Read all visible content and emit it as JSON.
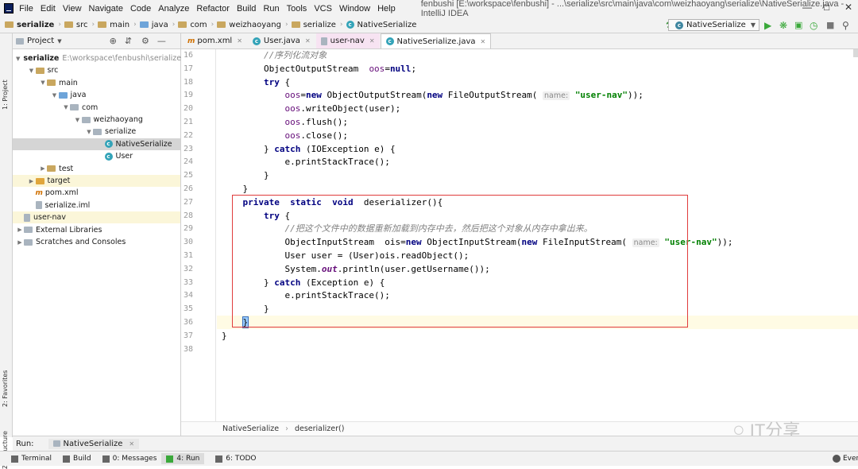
{
  "menu": {
    "items": [
      "File",
      "Edit",
      "View",
      "Navigate",
      "Code",
      "Analyze",
      "Refactor",
      "Build",
      "Run",
      "Tools",
      "VCS",
      "Window",
      "Help"
    ],
    "window_title": "fenbushi [E:\\workspace\\fenbushi] - ...\\serialize\\src\\main\\java\\com\\weizhaoyang\\serialize\\NativeSerialize.java - IntelliJ IDEA"
  },
  "navbar": {
    "crumbs": [
      "serialize",
      "src",
      "main",
      "java",
      "com",
      "weizhaoyang",
      "serialize",
      "NativeSerialize"
    ],
    "run_config": "NativeSerialize"
  },
  "left_strip": {
    "project_tab": "1: Project",
    "favorites_tab": "2: Favorites",
    "structure_tab": "Z: Structure"
  },
  "project_panel": {
    "header": "Project",
    "tree": [
      {
        "label": "serialize",
        "path": "E:\\workspace\\fenbushi\\serialize",
        "depth": 0,
        "icon": "module-folder-icon",
        "open": true,
        "bold": true
      },
      {
        "label": "src",
        "depth": 1,
        "icon": "folder-icon",
        "open": true
      },
      {
        "label": "main",
        "depth": 2,
        "icon": "folder-icon",
        "open": true
      },
      {
        "label": "java",
        "depth": 3,
        "icon": "source-folder-icon",
        "open": true
      },
      {
        "label": "com",
        "depth": 4,
        "icon": "package-icon",
        "open": true
      },
      {
        "label": "weizhaoyang",
        "depth": 5,
        "icon": "package-icon",
        "open": true
      },
      {
        "label": "serialize",
        "depth": 6,
        "icon": "package-icon",
        "open": true
      },
      {
        "label": "NativeSerialize",
        "depth": 7,
        "icon": "class-icon",
        "selected": true
      },
      {
        "label": "User",
        "depth": 7,
        "icon": "class-icon"
      },
      {
        "label": "test",
        "depth": 2,
        "icon": "folder-icon",
        "open": false
      },
      {
        "label": "target",
        "depth": 1,
        "icon": "excluded-folder-icon",
        "open": false,
        "highlight": true
      },
      {
        "label": "pom.xml",
        "depth": 1,
        "icon": "maven-icon"
      },
      {
        "label": "serialize.iml",
        "depth": 1,
        "icon": "iml-file-icon"
      },
      {
        "label": "user-nav",
        "depth": 0,
        "icon": "file-icon",
        "highlight": true
      },
      {
        "label": "External Libraries",
        "depth": 0,
        "icon": "library-icon",
        "open": false
      },
      {
        "label": "Scratches and Consoles",
        "depth": 0,
        "icon": "scratch-icon",
        "open": false
      }
    ]
  },
  "tabs": [
    {
      "label": "pom.xml",
      "icon": "maven-icon"
    },
    {
      "label": "User.java",
      "icon": "class-icon"
    },
    {
      "label": "user-nav",
      "icon": "file-icon",
      "pink": true
    },
    {
      "label": "NativeSerialize.java",
      "icon": "class-icon",
      "active": true
    }
  ],
  "editor": {
    "line_numbers": [
      "16",
      "17",
      "18",
      "19",
      "20",
      "21",
      "22",
      "23",
      "24",
      "25",
      "26",
      "27",
      "28",
      "29",
      "30",
      "31",
      "32",
      "33",
      "34",
      "35",
      "36",
      "37",
      "38"
    ],
    "current_line": "36",
    "lines": [
      [
        {
          "t": "        "
        },
        {
          "t": "//序列化流对象",
          "c": "cm"
        }
      ],
      [
        {
          "t": "        ObjectOutputStream  "
        },
        {
          "t": "oos",
          "c": "fld"
        },
        {
          "t": "="
        },
        {
          "t": "null",
          "c": "kw"
        },
        {
          "t": ";"
        }
      ],
      [
        {
          "t": "        "
        },
        {
          "t": "try",
          "c": "kw"
        },
        {
          "t": " {"
        }
      ],
      [
        {
          "t": "            "
        },
        {
          "t": "oos",
          "c": "fld"
        },
        {
          "t": "="
        },
        {
          "t": "new",
          "c": "kw"
        },
        {
          "t": " ObjectOutputStream("
        },
        {
          "t": "new",
          "c": "kw"
        },
        {
          "t": " FileOutputStream( "
        },
        {
          "t": "name:",
          "c": "hint"
        },
        {
          "t": " "
        },
        {
          "t": "\"user-nav\"",
          "c": "str"
        },
        {
          "t": "));"
        }
      ],
      [
        {
          "t": "            "
        },
        {
          "t": "oos",
          "c": "fld"
        },
        {
          "t": ".writeObject(user);"
        }
      ],
      [
        {
          "t": "            "
        },
        {
          "t": "oos",
          "c": "fld"
        },
        {
          "t": ".flush();"
        }
      ],
      [
        {
          "t": "            "
        },
        {
          "t": "oos",
          "c": "fld"
        },
        {
          "t": ".close();"
        }
      ],
      [
        {
          "t": "        } "
        },
        {
          "t": "catch",
          "c": "kw"
        },
        {
          "t": " (IOException e) {"
        }
      ],
      [
        {
          "t": "            e.printStackTrace();"
        }
      ],
      [
        {
          "t": "        }"
        }
      ],
      [
        {
          "t": "    }"
        }
      ],
      [
        {
          "t": "    "
        },
        {
          "t": "private",
          "c": "kw"
        },
        {
          "t": "  "
        },
        {
          "t": "static",
          "c": "kw"
        },
        {
          "t": "  "
        },
        {
          "t": "void",
          "c": "kw"
        },
        {
          "t": "  deserializer(){"
        }
      ],
      [
        {
          "t": "        "
        },
        {
          "t": "try",
          "c": "kw"
        },
        {
          "t": " {"
        }
      ],
      [
        {
          "t": "            "
        },
        {
          "t": "//把这个文件中的数据重新加载到内存中去，然后把这个对象从内存中拿出来。",
          "c": "cm"
        }
      ],
      [
        {
          "t": "            ObjectInputStream  ois="
        },
        {
          "t": "new",
          "c": "kw"
        },
        {
          "t": " ObjectInputStream("
        },
        {
          "t": "new",
          "c": "kw"
        },
        {
          "t": " FileInputStream( "
        },
        {
          "t": "name:",
          "c": "hint"
        },
        {
          "t": " "
        },
        {
          "t": "\"user-nav\"",
          "c": "str"
        },
        {
          "t": "));"
        }
      ],
      [
        {
          "t": "            User user = (User)ois.readObject();"
        }
      ],
      [
        {
          "t": "            System."
        },
        {
          "t": "out",
          "c": "st"
        },
        {
          "t": ".println(user.getUsername());"
        }
      ],
      [
        {
          "t": "        } "
        },
        {
          "t": "catch",
          "c": "kw"
        },
        {
          "t": " (Exception e) {"
        }
      ],
      [
        {
          "t": "            e.printStackTrace();"
        }
      ],
      [
        {
          "t": "        }"
        }
      ],
      [
        {
          "t": "    "
        },
        {
          "t": "}",
          "c": "brk"
        }
      ],
      [
        {
          "t": "}"
        }
      ],
      [
        {
          "t": ""
        }
      ]
    ]
  },
  "code_breadcrumb": {
    "cls": "NativeSerialize",
    "method": "deserializer()"
  },
  "runbar": {
    "label": "Run:",
    "config": "NativeSerialize"
  },
  "bottom_tabs": [
    "Terminal",
    "Build",
    "0: Messages",
    "4: Run",
    "6: TODO"
  ],
  "bottom_right": "Even",
  "watermark": "IT分享"
}
